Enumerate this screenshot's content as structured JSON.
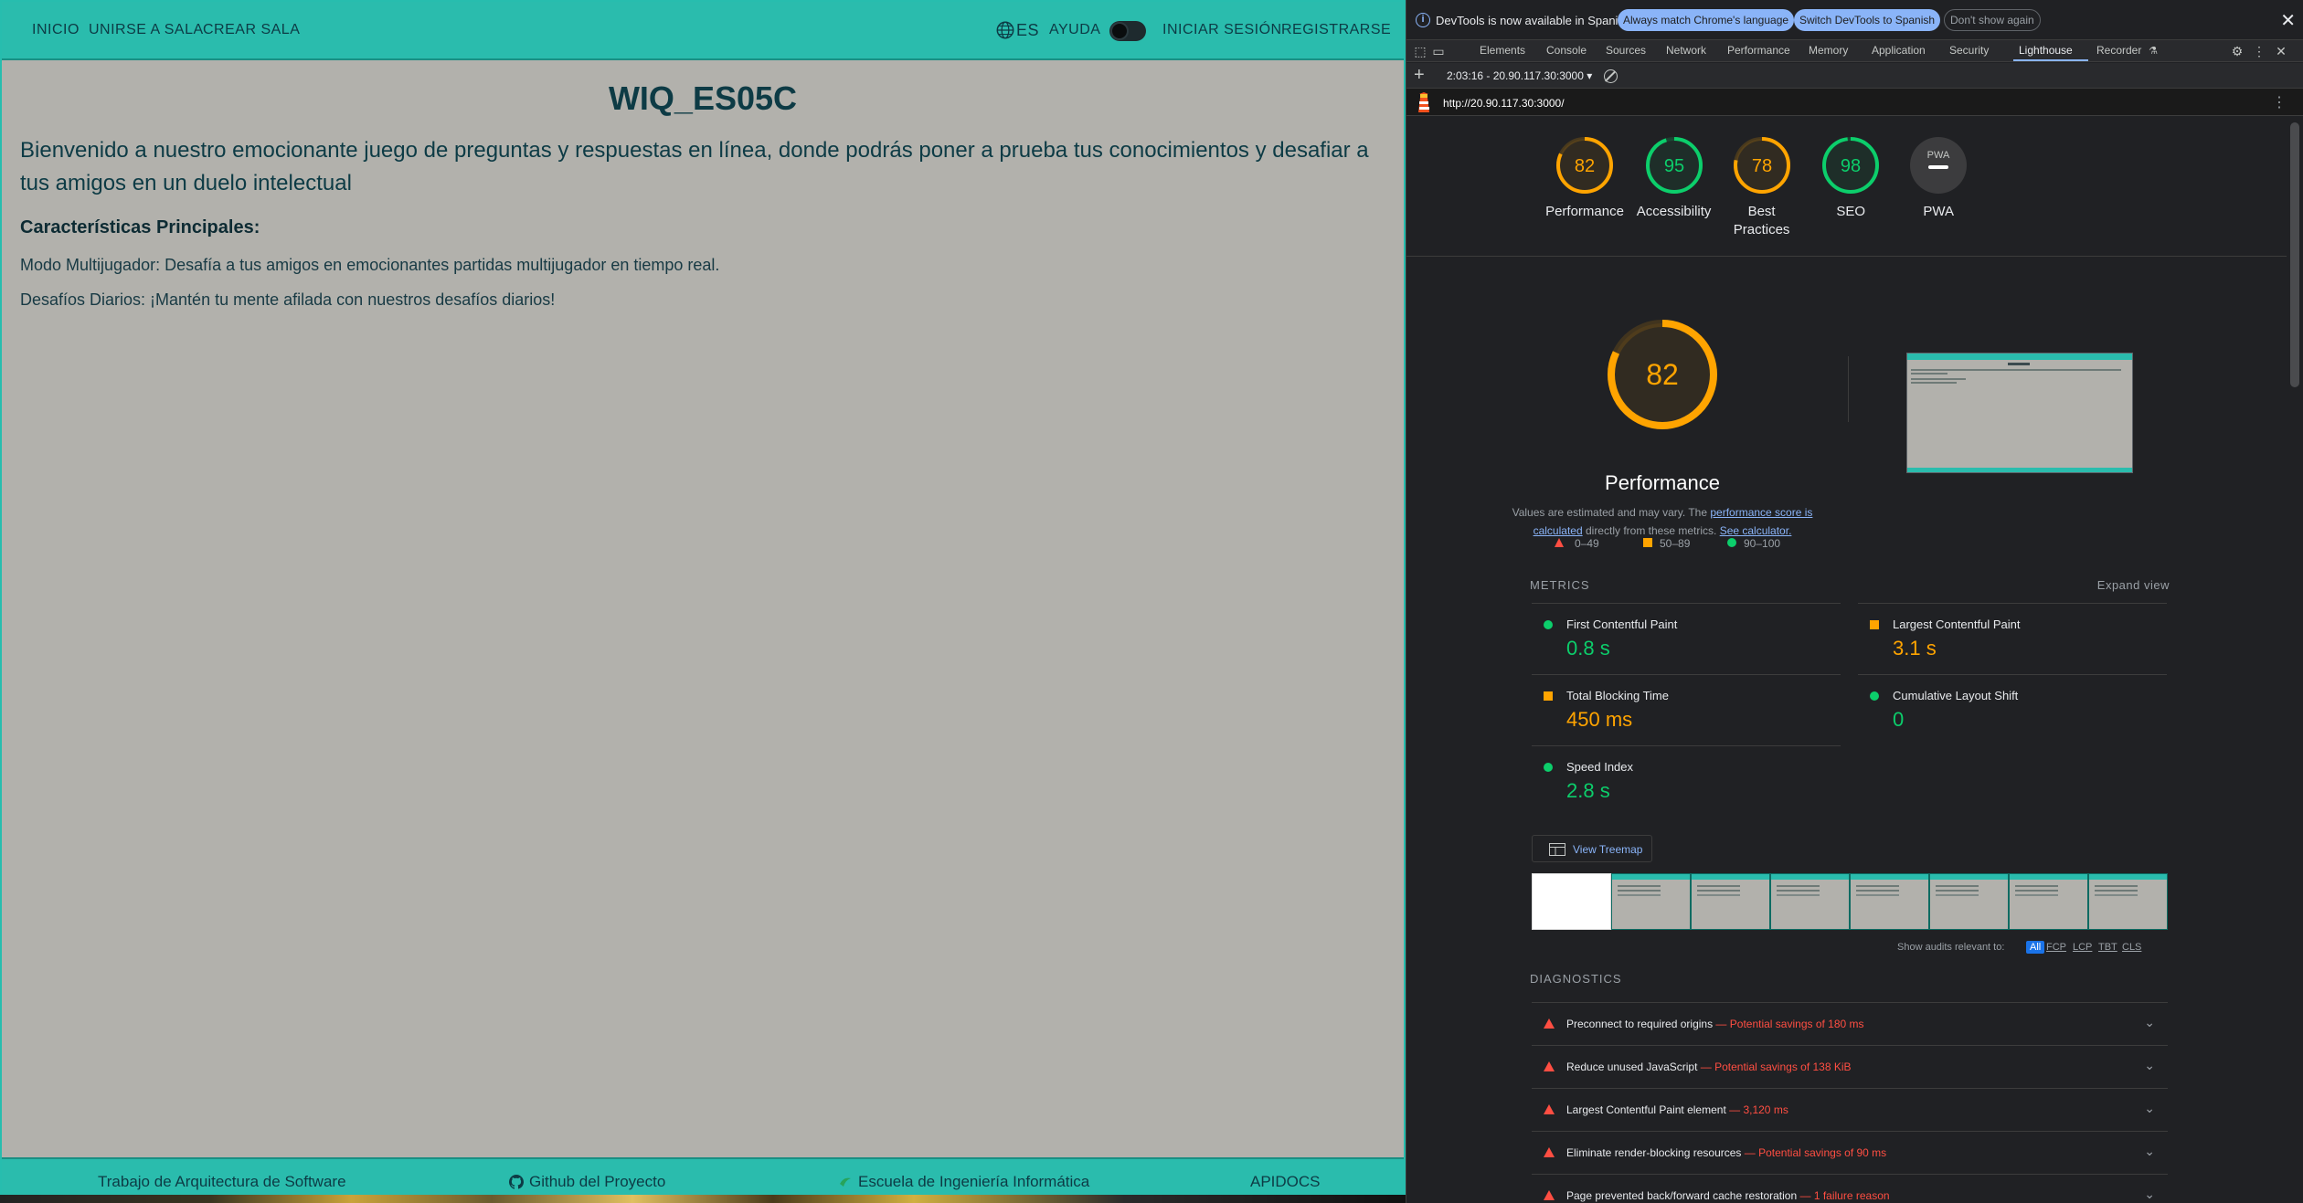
{
  "app": {
    "nav": {
      "left": [
        "INICIO",
        "UNIRSE A SALA",
        "CREAR SALA"
      ],
      "lang": "ES",
      "help": "AYUDA",
      "login": "INICIAR SESIÓN",
      "register": "REGISTRARSE"
    },
    "title": "WIQ_ES05C",
    "intro": "Bienvenido a nuestro emocionante juego de preguntas y respuestas en línea, donde podrás poner a prueba tus conocimientos y desafiar a tus amigos en un duelo intelectual",
    "features_title": "Características Principales:",
    "features": [
      "Modo Multijugador: Desafía a tus amigos en emocionantes partidas multijugador en tiempo real.",
      "Desafíos Diarios: ¡Mantén tu mente afilada con nuestros desafíos diarios!"
    ],
    "footer": {
      "course": "Trabajo de Arquitectura de Software",
      "github": "Github del Proyecto",
      "school": "Escuela de Ingeniería Informática",
      "apidocs": "APIDOCS"
    }
  },
  "devtools": {
    "infobar": {
      "text": "DevTools is now available in Spanish!",
      "btn_match": "Always match Chrome's language",
      "btn_switch": "Switch DevTools to Spanish",
      "btn_dismiss": "Don't show again"
    },
    "tabs": [
      "Elements",
      "Console",
      "Sources",
      "Network",
      "Performance",
      "Memory",
      "Application",
      "Security",
      "Lighthouse",
      "Recorder"
    ],
    "active_tab": "Lighthouse",
    "run_select": "2:03:16 - 20.90.117.30:3000 ▾",
    "url": "http://20.90.117.30:3000/",
    "summary": [
      {
        "label": "Performance",
        "score": "82",
        "value": 82,
        "color": "#ffa400"
      },
      {
        "label": "Accessibility",
        "score": "95",
        "value": 95,
        "color": "#0cce6b"
      },
      {
        "label": "Best Practices",
        "score": "78",
        "value": 78,
        "color": "#ffa400"
      },
      {
        "label": "SEO",
        "score": "98",
        "value": 98,
        "color": "#0cce6b"
      },
      {
        "label": "PWA",
        "score": "PWA",
        "value": null,
        "color": "#9aa0a6"
      }
    ],
    "perf": {
      "score": "82",
      "value": 82,
      "title": "Performance",
      "desc_a": "Values are estimated and may vary. The ",
      "desc_link1": "performance score is calculated",
      "desc_b": " directly from these metrics. ",
      "desc_link2": "See calculator.",
      "legend": [
        "0–49",
        "50–89",
        "90–100"
      ]
    },
    "metrics_label": "METRICS",
    "expand_view": "Expand view",
    "metrics": [
      {
        "name": "First Contentful Paint",
        "value": "0.8 s",
        "status": "pass"
      },
      {
        "name": "Largest Contentful Paint",
        "value": "3.1 s",
        "status": "avg"
      },
      {
        "name": "Total Blocking Time",
        "value": "450 ms",
        "status": "avg"
      },
      {
        "name": "Cumulative Layout Shift",
        "value": "0",
        "status": "pass"
      },
      {
        "name": "Speed Index",
        "value": "2.8 s",
        "status": "pass"
      }
    ],
    "treemap": "View Treemap",
    "filter_label": "Show audits relevant to:",
    "filters": [
      "All",
      "FCP",
      "LCP",
      "TBT",
      "CLS"
    ],
    "diagnostics_label": "DIAGNOSTICS",
    "diagnostics": [
      {
        "title": "Preconnect to required origins",
        "savings": "Potential savings of 180 ms"
      },
      {
        "title": "Reduce unused JavaScript",
        "savings": "Potential savings of 138 KiB"
      },
      {
        "title": "Largest Contentful Paint element",
        "savings": "3,120 ms"
      },
      {
        "title": "Eliminate render-blocking resources",
        "savings": "Potential savings of 90 ms"
      },
      {
        "title": "Page prevented back/forward cache restoration",
        "savings": "1 failure reason"
      }
    ]
  }
}
